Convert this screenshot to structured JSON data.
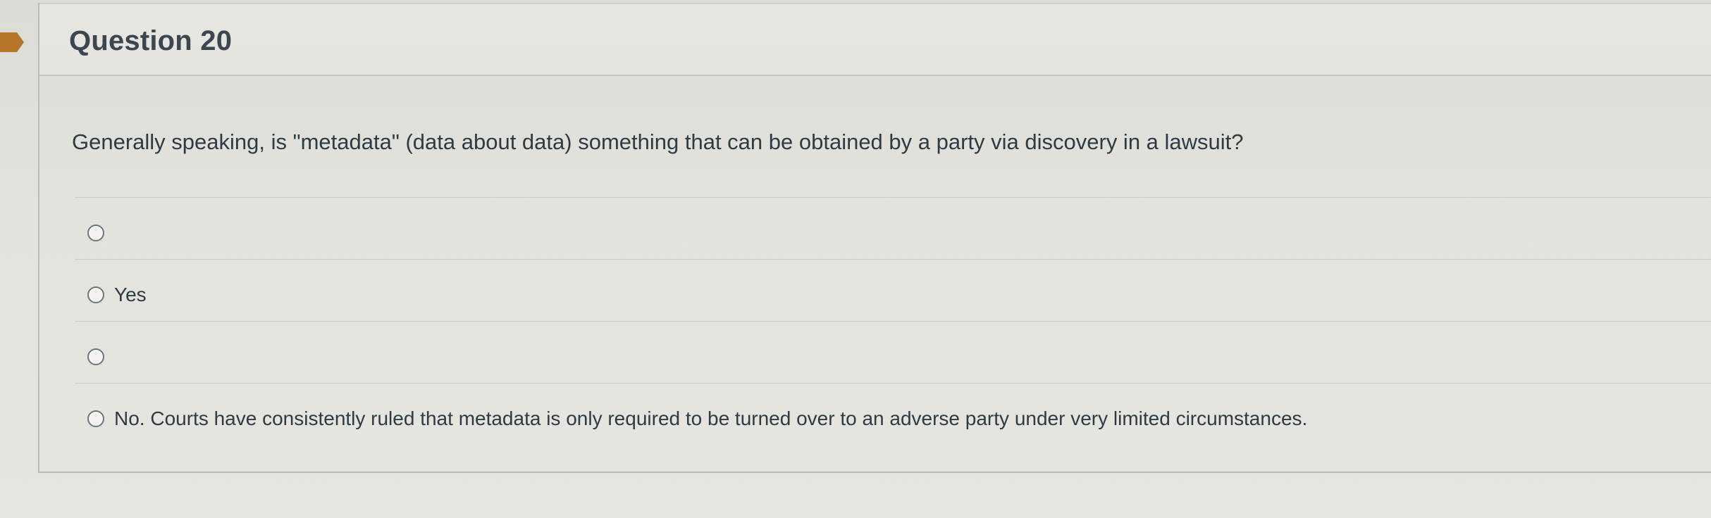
{
  "question": {
    "title": "Question 20",
    "text": "Generally speaking, is \"metadata\" (data about data) something that can be obtained by a party via discovery in a lawsuit?",
    "answers": [
      {
        "label": ""
      },
      {
        "label": "Yes"
      },
      {
        "label": ""
      },
      {
        "label": "No. Courts have consistently ruled that metadata is only required to be turned over to an adverse party under very limited circumstances."
      }
    ]
  },
  "colors": {
    "flag": "#b5762a",
    "text": "#2d3b45",
    "border": "#c4c3be"
  }
}
